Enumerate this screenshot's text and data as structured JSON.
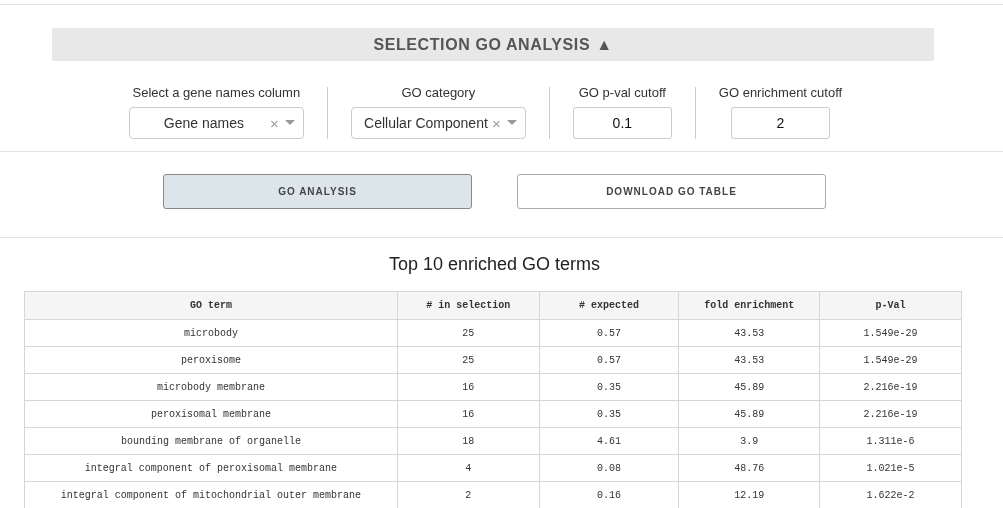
{
  "section_header": {
    "title": "SELECTION GO ANALYSIS",
    "toggle_glyph": "▲"
  },
  "controls": [
    {
      "kind": "select",
      "label": "Select a gene names column",
      "value": "Gene names",
      "clear_glyph": "×"
    },
    {
      "kind": "select",
      "label": "GO category",
      "value": "Cellular Component",
      "clear_glyph": "×"
    },
    {
      "kind": "input",
      "label": "GO p-val cutoff",
      "value": "0.1"
    },
    {
      "kind": "input",
      "label": "GO enrichment cutoff",
      "value": "2"
    }
  ],
  "buttons": [
    {
      "label": "GO ANALYSIS",
      "active": true
    },
    {
      "label": "DOWNLOAD GO TABLE",
      "active": false
    }
  ],
  "table": {
    "title": "Top 10 enriched GO terms",
    "columns": [
      "GO term",
      "# in selection",
      "# expected",
      "fold enrichment",
      "p-Val"
    ],
    "rows": [
      [
        "microbody",
        "25",
        "0.57",
        "43.53",
        "1.549e-29"
      ],
      [
        "peroxisome",
        "25",
        "0.57",
        "43.53",
        "1.549e-29"
      ],
      [
        "microbody membrane",
        "16",
        "0.35",
        "45.89",
        "2.216e-19"
      ],
      [
        "peroxisomal membrane",
        "16",
        "0.35",
        "45.89",
        "2.216e-19"
      ],
      [
        "bounding membrane of organelle",
        "18",
        "4.61",
        "3.9",
        "1.311e-6"
      ],
      [
        "integral component of peroxisomal membrane",
        "4",
        "0.08",
        "48.76",
        "1.021e-5"
      ],
      [
        "integral component of mitochondrial outer membrane",
        "2",
        "0.16",
        "12.19",
        "1.622e-2"
      ]
    ]
  }
}
